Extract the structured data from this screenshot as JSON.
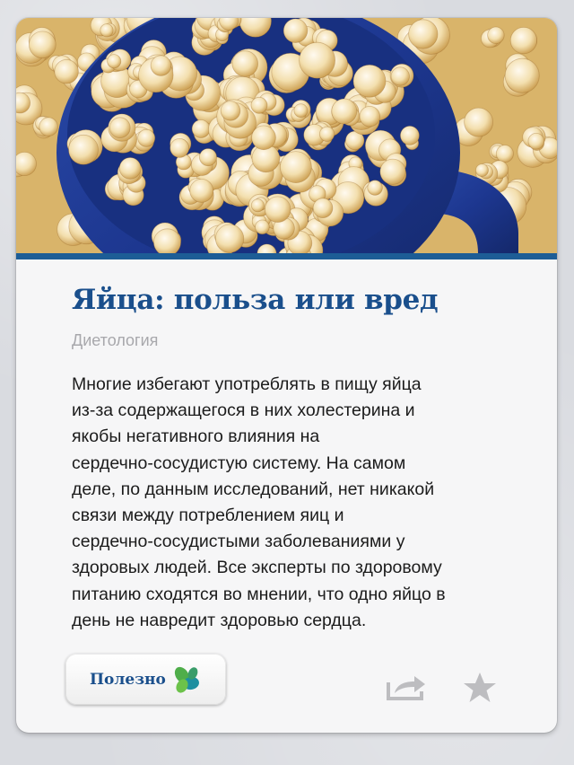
{
  "article": {
    "title": "Яйца: польза или вред",
    "category": "Диетология",
    "body_lines": [
      "Многие избегают употреблять в пищу яйца",
      "из-за содержащегося в них холестерина и",
      "якобы негативного влияния на",
      "сердечно-сосудистую систему. На самом",
      "деле, по данным исследований, нет никакой",
      "связи между потреблением яиц и",
      "сердечно-сосудистыми заболеваниями у",
      "здоровых людей. Все эксперты по здоровому",
      "питанию сходятся во мнении, что одно яйцо в",
      "день не навредит здоровью сердца."
    ]
  },
  "hero": {
    "image": "popcorn-in-blue-mug-photo"
  },
  "actions": {
    "useful_label": "Полезно",
    "useful_icon": "leaf-icon",
    "share_icon": "share-icon",
    "favorite_icon": "star-icon"
  },
  "colors": {
    "accent_blue": "#1d5d96",
    "title_blue": "#1a4f8c",
    "category_gray": "#a8a8ac",
    "leaf_green": "#4fae4a",
    "leaf_teal": "#1e8fa0",
    "icon_gray": "#bdbdc0"
  }
}
